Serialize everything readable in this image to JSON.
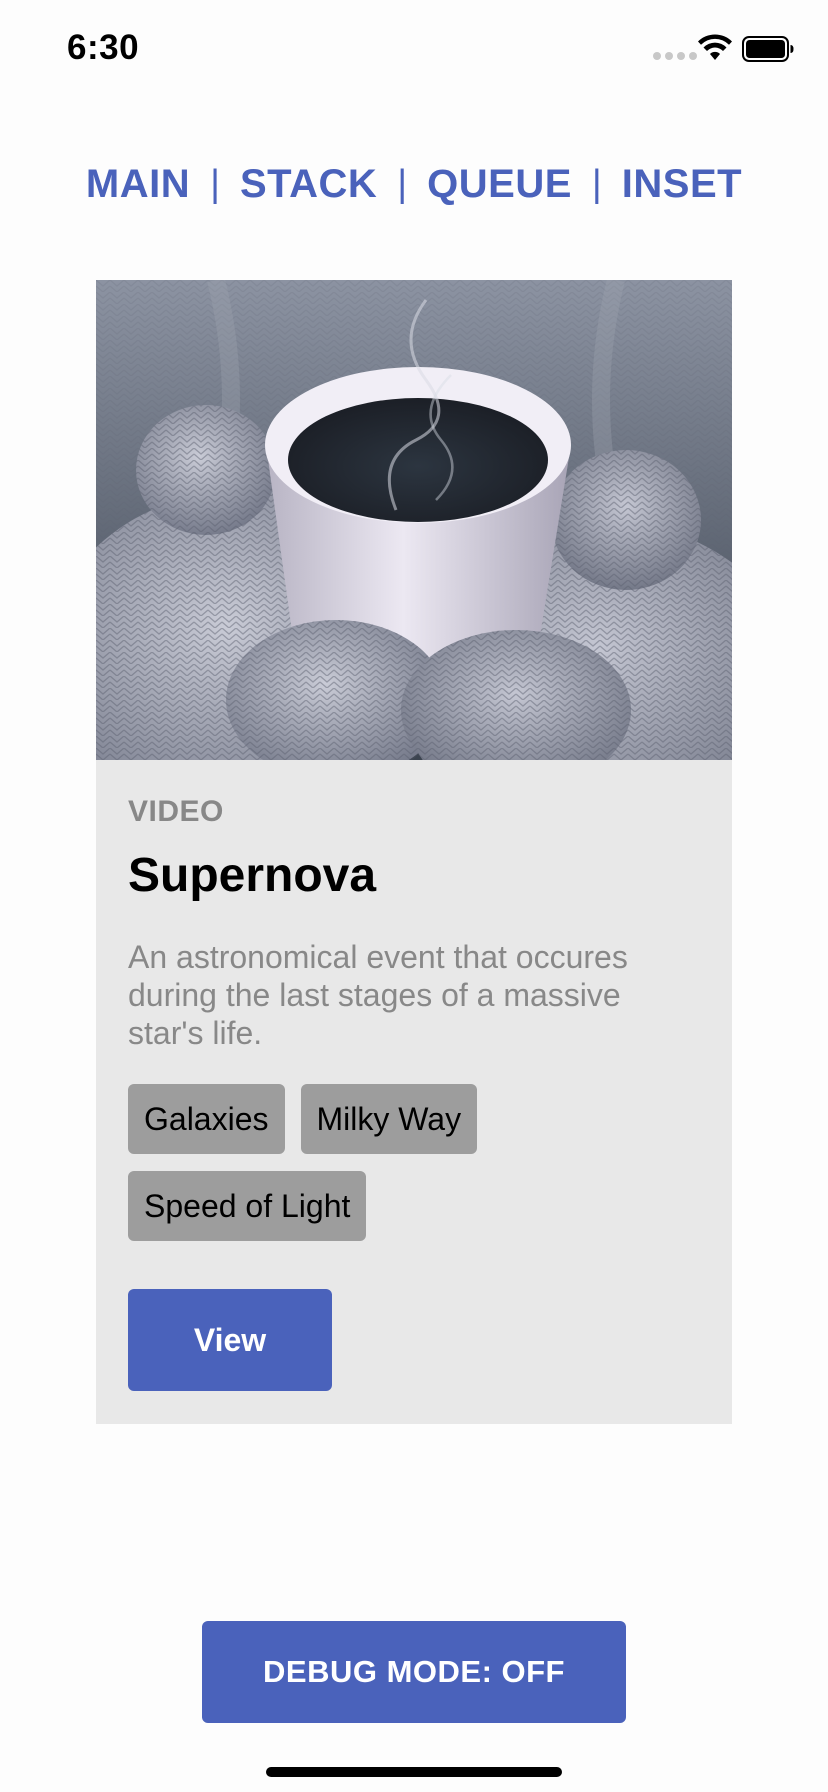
{
  "status_bar": {
    "time": "6:30",
    "icons": [
      "signal-icon",
      "wifi-icon",
      "battery-icon"
    ]
  },
  "nav": {
    "items": [
      {
        "label": "MAIN"
      },
      {
        "label": "STACK"
      },
      {
        "label": "QUEUE"
      },
      {
        "label": "INSET"
      }
    ],
    "separator": "|"
  },
  "card": {
    "image": "coffee-cup-in-mittens-photo",
    "eyebrow": "VIDEO",
    "title": "Supernova",
    "description": "An astronomical event that occures during the last stages of a massive star's life.",
    "tags": [
      "Galaxies",
      "Milky Way",
      "Speed of Light"
    ],
    "button_label": "View"
  },
  "debug_button": {
    "label": "DEBUG MODE: OFF"
  },
  "colors": {
    "accent": "#4a62bb",
    "card_background": "#e8e8e8",
    "tag_background": "#9d9d9d",
    "muted_text": "#888888"
  }
}
